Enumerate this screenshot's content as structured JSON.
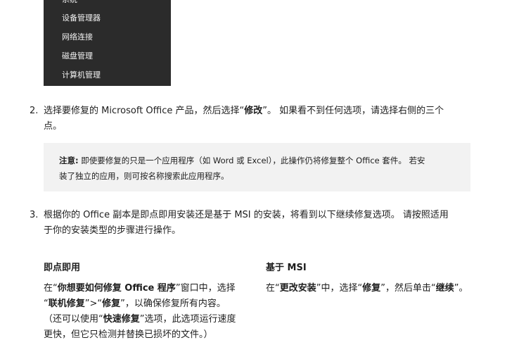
{
  "menu": {
    "items": [
      "系统",
      "设备管理器",
      "网络连接",
      "磁盘管理",
      "计算机管理"
    ]
  },
  "step2": {
    "number": "2.",
    "pre": "选择要修复的 Microsoft Office 产品，然后选择“",
    "bold": "修改",
    "post": "”。 如果看不到任何选项，请选择右侧的三个",
    "line2": "点。"
  },
  "note": {
    "label": "注意:",
    "line1": " 即使要修复的只是一个应用程序（如 Word 或 Excel），此操作仍将修复整个 Office 套件。 若安",
    "line2": "装了独立的应用，则可按名称搜索此应用程序。"
  },
  "step3": {
    "number": "3.",
    "line1": "根据你的 Office 副本是即点即用安装还是基于 MSI 的安装，将看到以下继续修复选项。 请按照适用",
    "line2": "于你的安装类型的步骤进行操作。"
  },
  "c2r": {
    "heading": "即点即用",
    "l1_a": "在“",
    "l1_b": "你想要如何修复 Office 程序",
    "l1_c": "”窗口中，选择",
    "l2_a": "“",
    "l2_b": "联机修复",
    "l2_c": "”>“",
    "l2_d": "修复",
    "l2_e": "”，以确保修复所有内容。",
    "l3_a": "（还可以使用“",
    "l3_b": "快速修复",
    "l3_c": "”选项，此选项运行速度",
    "l4": "更快，但它只检测并替换已损坏的文件。）"
  },
  "msi": {
    "heading": "基于 MSI",
    "a": "在“",
    "b": "更改安装",
    "c": "”中，选择“",
    "d": "修复",
    "e": "”，然后单击“",
    "f": "继续",
    "g": "”。"
  }
}
